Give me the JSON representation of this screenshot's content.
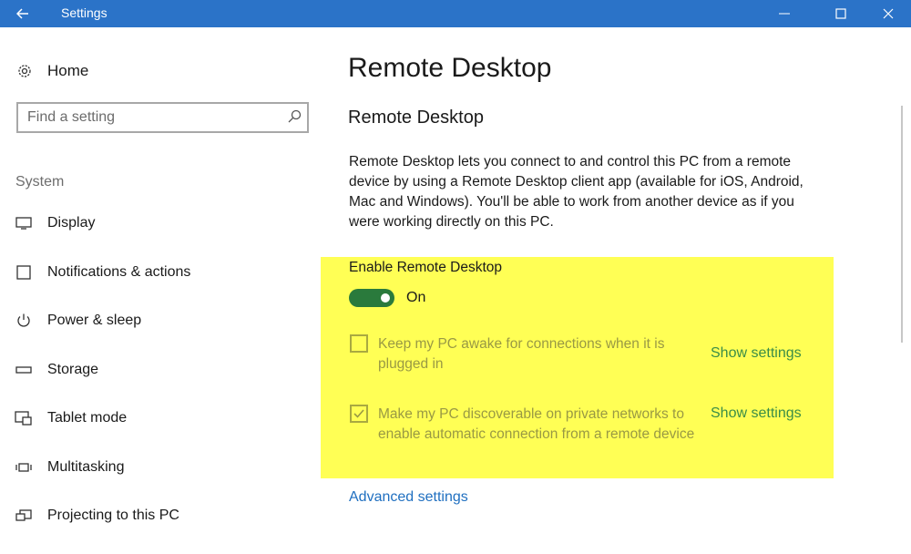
{
  "window": {
    "title": "Settings",
    "accent": "#2b73c8"
  },
  "sidebar": {
    "home_label": "Home",
    "search_placeholder": "Find a setting",
    "section_label": "System",
    "items": [
      {
        "label": "Display",
        "icon": "monitor-icon"
      },
      {
        "label": "Notifications & actions",
        "icon": "notifications-icon"
      },
      {
        "label": "Power & sleep",
        "icon": "power-icon"
      },
      {
        "label": "Storage",
        "icon": "storage-icon"
      },
      {
        "label": "Tablet mode",
        "icon": "tablet-mode-icon"
      },
      {
        "label": "Multitasking",
        "icon": "multitasking-icon"
      },
      {
        "label": "Projecting to this PC",
        "icon": "projecting-icon"
      }
    ]
  },
  "main": {
    "page_title": "Remote Desktop",
    "section_title": "Remote Desktop",
    "description": "Remote Desktop lets you connect to and control this PC from a remote device by using a Remote Desktop client app (available for iOS, Android, Mac and Windows). You'll be able to work from another device as if you were working directly on this PC.",
    "enable_label": "Enable Remote Desktop",
    "toggle_state": "On",
    "toggle_color": "#2a7a3c",
    "highlight_color": "#ffff55",
    "options": [
      {
        "text": "Keep my PC awake for connections when it is plugged in",
        "checked": false,
        "link": "Show settings"
      },
      {
        "text": "Make my PC discoverable on private networks to enable automatic connection from a remote device",
        "checked": true,
        "link": "Show settings"
      }
    ],
    "advanced_link": "Advanced settings"
  }
}
